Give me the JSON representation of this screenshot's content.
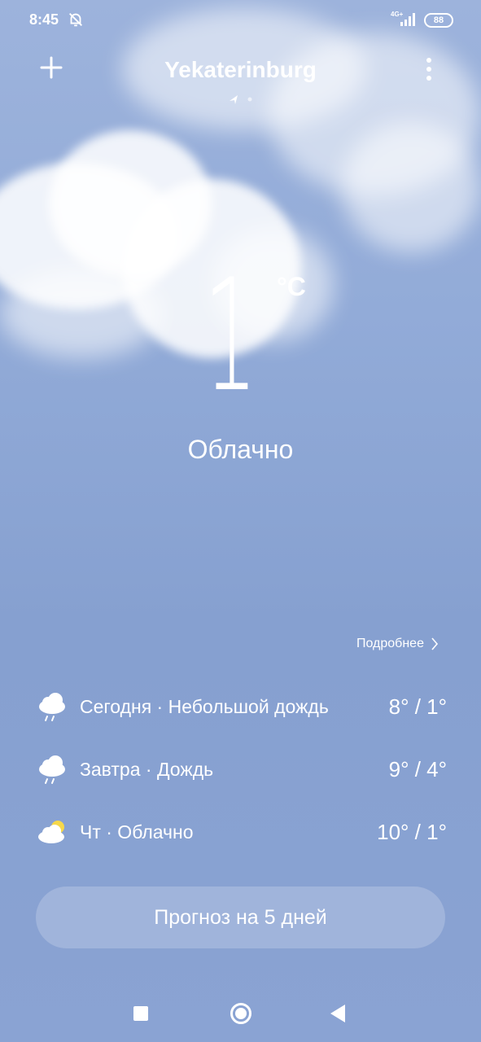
{
  "status_bar": {
    "time": "8:45",
    "network": "4G+",
    "battery": "88",
    "icons": [
      "bell-off-icon",
      "signal-icon",
      "battery-icon"
    ]
  },
  "header": {
    "city": "Yekaterinburg",
    "add_icon": "plus-icon",
    "menu_icon": "more-vertical-icon",
    "page_indicator_icons": [
      "location-arrow-icon",
      "dot-icon"
    ]
  },
  "current": {
    "temperature": "1",
    "unit": "°C",
    "condition": "Облачно"
  },
  "details_link": "Подробнее",
  "forecast": [
    {
      "label": "Сегодня · Небольшой дождь",
      "temps": "8° / 1°",
      "icon": "rain-cloud-icon"
    },
    {
      "label": "Завтра · Дождь",
      "temps": "9° / 4°",
      "icon": "rain-cloud-icon"
    },
    {
      "label": "Чт · Облачно",
      "temps": "10° / 1°",
      "icon": "partly-cloudy-icon"
    }
  ],
  "forecast_button": "Прогноз на 5 дней",
  "colors": {
    "sky_top": "#9db3dc",
    "sky_bottom": "#8aa3d3",
    "sun": "#f6d84a"
  }
}
